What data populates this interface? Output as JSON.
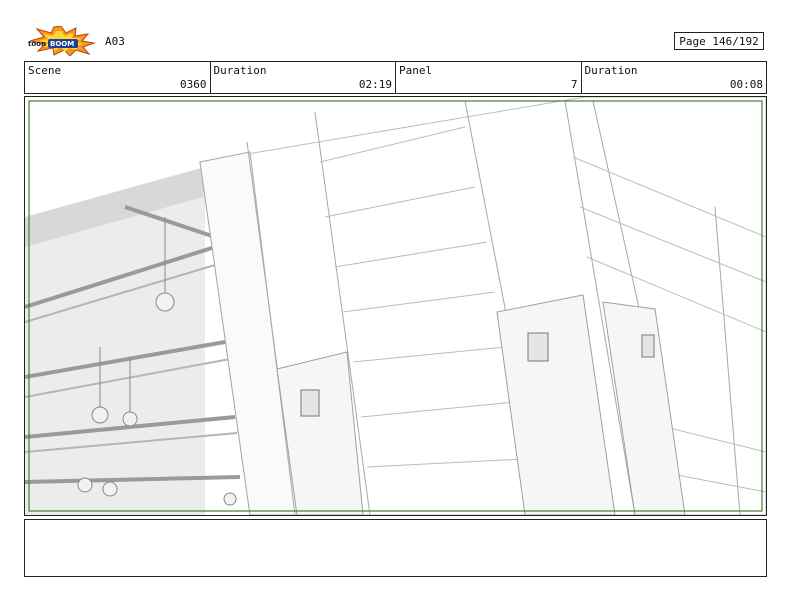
{
  "header": {
    "logo_text": "toonboom",
    "sequence": "A03",
    "page": "Page 146/192"
  },
  "info": {
    "scene_label": "Scene",
    "scene_value": "0360",
    "duration_label": "Duration",
    "duration_value": "02:19",
    "panel_label": "Panel",
    "panel_value": "7",
    "panel_duration_label": "Duration",
    "panel_duration_value": "00:08"
  },
  "notes": {
    "text": ""
  }
}
